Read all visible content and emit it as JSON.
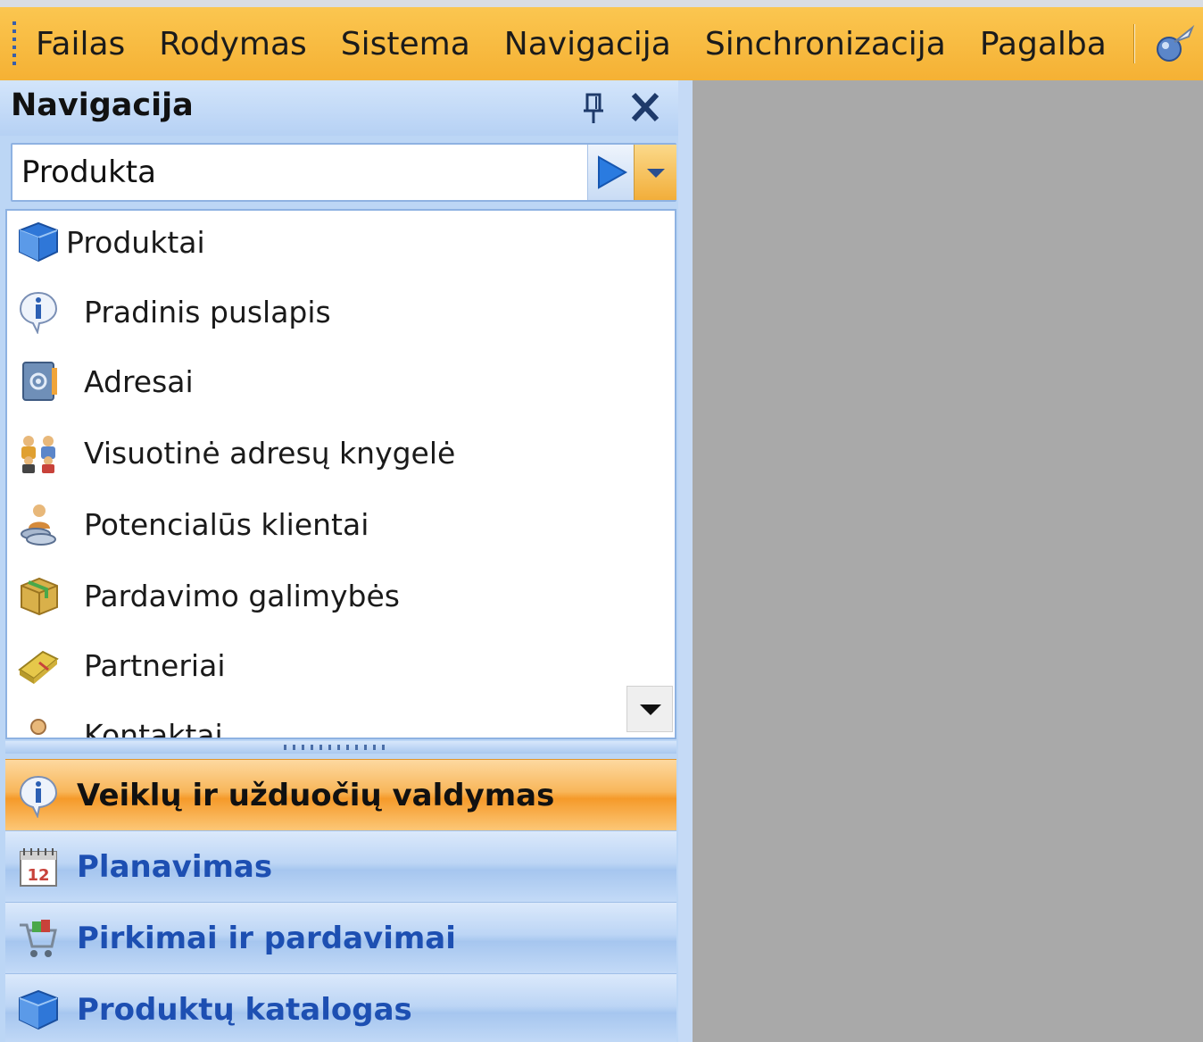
{
  "menubar": {
    "items": [
      "Failas",
      "Rodymas",
      "Sistema",
      "Navigacija",
      "Sinchronizacija",
      "Pagalba"
    ],
    "help_icon": "help-pointer-icon"
  },
  "navigation": {
    "title": "Navigacija",
    "search": {
      "value": "Produkta"
    },
    "list": [
      {
        "label": "Produktai",
        "icon": "cube-icon",
        "root": true
      },
      {
        "label": "Pradinis puslapis",
        "icon": "info-icon"
      },
      {
        "label": "Adresai",
        "icon": "address-book-icon"
      },
      {
        "label": "Visuotinė adresų knygelė",
        "icon": "people-group-icon"
      },
      {
        "label": "Potencialūs klientai",
        "icon": "person-money-icon"
      },
      {
        "label": "Pardavimo galimybės",
        "icon": "gift-box-icon"
      },
      {
        "label": "Partneriai",
        "icon": "handshake-book-icon"
      },
      {
        "label": "Kontaktai",
        "icon": "contact-person-icon"
      }
    ],
    "sections": [
      {
        "label": "Veiklų ir užduočių valdymas",
        "icon": "info-icon",
        "active": true
      },
      {
        "label": "Planavimas",
        "icon": "calendar-icon",
        "active": false
      },
      {
        "label": "Pirkimai ir pardavimai",
        "icon": "shopping-cart-icon",
        "active": false
      },
      {
        "label": "Produktų katalogas",
        "icon": "cube-icon",
        "active": false
      }
    ],
    "calendar_day": "12"
  },
  "colors": {
    "menubar": "#f5b134",
    "panel": "#bcd6f5",
    "active_section": "#f59a2a",
    "section_text": "#1d4fb2",
    "workspace": "#a9a9a9"
  }
}
